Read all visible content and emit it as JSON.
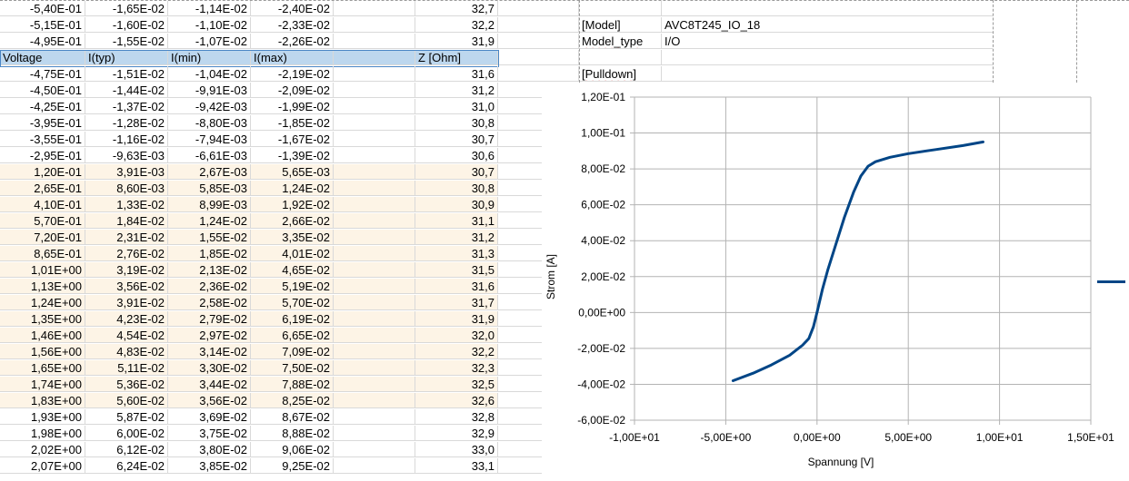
{
  "sheet": {
    "rows_above": [
      [
        "-5,40E-01",
        "-1,65E-02",
        "-1,14E-02",
        "-2,40E-02",
        "",
        "32,7"
      ],
      [
        "-5,15E-01",
        "-1,60E-02",
        "-1,10E-02",
        "-2,33E-02",
        "",
        "32,2"
      ],
      [
        "-4,95E-01",
        "-1,55E-02",
        "-1,07E-02",
        "-2,26E-02",
        "",
        "31,9"
      ]
    ],
    "header": [
      "Voltage",
      "I(typ)",
      "I(min)",
      "I(max)",
      "",
      "Z [Ohm]"
    ],
    "rows": [
      [
        "-4,75E-01",
        "-1,51E-02",
        "-1,04E-02",
        "-2,19E-02",
        "",
        "31,6"
      ],
      [
        "-4,50E-01",
        "-1,44E-02",
        "-9,91E-03",
        "-2,09E-02",
        "",
        "31,2"
      ],
      [
        "-4,25E-01",
        "-1,37E-02",
        "-9,42E-03",
        "-1,99E-02",
        "",
        "31,0"
      ],
      [
        "-3,95E-01",
        "-1,28E-02",
        "-8,80E-03",
        "-1,85E-02",
        "",
        "30,8"
      ],
      [
        "-3,55E-01",
        "-1,16E-02",
        "-7,94E-03",
        "-1,67E-02",
        "",
        "30,7"
      ],
      [
        "-2,95E-01",
        "-9,63E-03",
        "-6,61E-03",
        "-1,39E-02",
        "",
        "30,6"
      ],
      [
        "1,20E-01",
        "3,91E-03",
        "2,67E-03",
        "5,65E-03",
        "",
        "30,7"
      ],
      [
        "2,65E-01",
        "8,60E-03",
        "5,85E-03",
        "1,24E-02",
        "",
        "30,8"
      ],
      [
        "4,10E-01",
        "1,33E-02",
        "8,99E-03",
        "1,92E-02",
        "",
        "30,9"
      ],
      [
        "5,70E-01",
        "1,84E-02",
        "1,24E-02",
        "2,66E-02",
        "",
        "31,1"
      ],
      [
        "7,20E-01",
        "2,31E-02",
        "1,55E-02",
        "3,35E-02",
        "",
        "31,2"
      ],
      [
        "8,65E-01",
        "2,76E-02",
        "1,85E-02",
        "4,01E-02",
        "",
        "31,3"
      ],
      [
        "1,01E+00",
        "3,19E-02",
        "2,13E-02",
        "4,65E-02",
        "",
        "31,5"
      ],
      [
        "1,13E+00",
        "3,56E-02",
        "2,36E-02",
        "5,19E-02",
        "",
        "31,6"
      ],
      [
        "1,24E+00",
        "3,91E-02",
        "2,58E-02",
        "5,70E-02",
        "",
        "31,7"
      ],
      [
        "1,35E+00",
        "4,23E-02",
        "2,79E-02",
        "6,19E-02",
        "",
        "31,9"
      ],
      [
        "1,46E+00",
        "4,54E-02",
        "2,97E-02",
        "6,65E-02",
        "",
        "32,0"
      ],
      [
        "1,56E+00",
        "4,83E-02",
        "3,14E-02",
        "7,09E-02",
        "",
        "32,2"
      ],
      [
        "1,65E+00",
        "5,11E-02",
        "3,30E-02",
        "7,50E-02",
        "",
        "32,3"
      ],
      [
        "1,74E+00",
        "5,36E-02",
        "3,44E-02",
        "7,88E-02",
        "",
        "32,5"
      ],
      [
        "1,83E+00",
        "5,60E-02",
        "3,56E-02",
        "8,25E-02",
        "",
        "32,6"
      ],
      [
        "1,93E+00",
        "5,87E-02",
        "3,69E-02",
        "8,67E-02",
        "",
        "32,8"
      ],
      [
        "1,98E+00",
        "6,00E-02",
        "3,75E-02",
        "8,88E-02",
        "",
        "32,9"
      ],
      [
        "2,02E+00",
        "6,12E-02",
        "3,80E-02",
        "9,06E-02",
        "",
        "33,0"
      ],
      [
        "2,07E+00",
        "6,24E-02",
        "3,85E-02",
        "9,25E-02",
        "",
        "33,1"
      ]
    ],
    "side": {
      "model_key": "[Model]",
      "model_value": "AVC8T245_IO_18",
      "model_type_key": "Model_type",
      "model_type_value": "I/O",
      "pulldown_key": "[Pulldown]"
    },
    "highlight_color": "#fdf4e6",
    "header_color": "#bdd7ee"
  },
  "chart_data": {
    "type": "line",
    "xlabel": "Spannung [V]",
    "ylabel": "Strom [A]",
    "xlim": [
      -10,
      15
    ],
    "ylim": [
      -0.06,
      0.12
    ],
    "x_ticks": [
      "-1,00E+01",
      "-5,00E+00",
      "0,00E+00",
      "5,00E+00",
      "1,00E+01",
      "1,50E+01"
    ],
    "y_ticks": [
      "-6,00E-02",
      "-4,00E-02",
      "-2,00E-02",
      "0,00E+00",
      "2,00E-02",
      "4,00E-02",
      "6,00E-02",
      "8,00E-02",
      "1,00E-01",
      "1,20E-01"
    ],
    "series_color": "#004586",
    "series": [
      {
        "x": [
          -4.6,
          -3.5,
          -2.5,
          -1.5,
          -0.8,
          -0.45,
          -0.2,
          0.0,
          0.3,
          0.6,
          1.0,
          1.5,
          2.0,
          2.4,
          2.8,
          3.2,
          4.0,
          5.0,
          6.5,
          8.0,
          9.1
        ],
        "y": [
          -0.038,
          -0.0338,
          -0.0292,
          -0.0238,
          -0.0183,
          -0.0145,
          -0.008,
          0.0,
          0.013,
          0.024,
          0.037,
          0.053,
          0.067,
          0.076,
          0.0815,
          0.084,
          0.0865,
          0.0885,
          0.0908,
          0.093,
          0.095
        ]
      }
    ]
  }
}
